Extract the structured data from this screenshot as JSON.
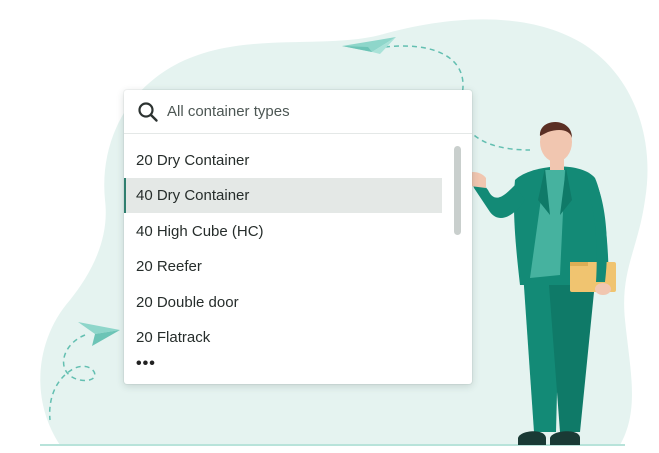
{
  "search": {
    "placeholder": "All container types",
    "icon": "search-icon"
  },
  "options": [
    {
      "label": "20 Dry Container",
      "selected": false
    },
    {
      "label": "40 Dry Container",
      "selected": true
    },
    {
      "label": "40 High Cube (HC)",
      "selected": false
    },
    {
      "label": "20 Reefer",
      "selected": false
    },
    {
      "label": "20 Double door",
      "selected": false
    },
    {
      "label": "20 Flatrack",
      "selected": false
    }
  ],
  "more_indicator": "•••",
  "colors": {
    "background_blob": "#e5f3f0",
    "accent": "#2f7f6f",
    "suit": "#138a76",
    "shirt": "#46b29f",
    "folder": "#f0c470",
    "selected_row": "#e4e8e6"
  }
}
